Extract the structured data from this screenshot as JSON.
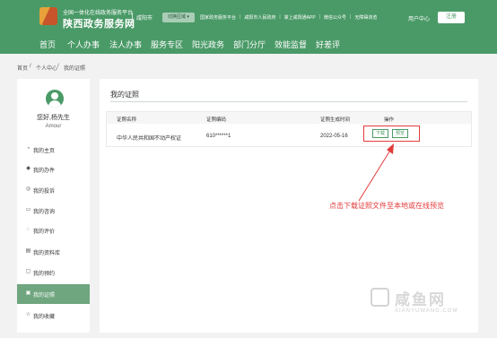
{
  "header": {
    "subtitle": "全国一体化在线政务服务平台",
    "site_title": "陕西政务服务网",
    "city": "咸阳市",
    "region_button": "切换区域 ▾",
    "links": [
      "国家政务服务平台",
      "咸阳市人民政府",
      "掌上咸阳通APP",
      "微信公众号",
      "无障碍浏览"
    ],
    "user_center": "用户中心",
    "register": "注册"
  },
  "nav": {
    "items": [
      "首页",
      "个人办事",
      "法人办事",
      "服务专区",
      "阳光政务",
      "部门分厅",
      "效能监督",
      "好差评"
    ]
  },
  "breadcrumb": {
    "home": "首页",
    "sep": "/",
    "personal": "个人中心",
    "current": "我的证照"
  },
  "sidebar": {
    "greeting": "您好,杨先生",
    "username": "Amour",
    "menu": [
      {
        "icon": "◔",
        "label": "我的主页"
      },
      {
        "icon": "◆",
        "label": "我的办件"
      },
      {
        "icon": "◎",
        "label": "我的投诉"
      },
      {
        "icon": "▭",
        "label": "我的咨询"
      },
      {
        "icon": "◌",
        "label": "我的评价"
      },
      {
        "icon": "▤",
        "label": "我的资料库"
      },
      {
        "icon": "▢",
        "label": "我的预约"
      },
      {
        "icon": "▣",
        "label": "我的证照"
      },
      {
        "icon": "☆",
        "label": "我的收藏"
      }
    ],
    "active_index": 7
  },
  "main": {
    "section_title": "我的证照",
    "columns": [
      "证照名称",
      "证照编码",
      "证照生成时间",
      "操作"
    ],
    "rows": [
      {
        "name": "中华人民共和国不动产权证",
        "code": "610******1",
        "date": "2022-05-16"
      }
    ],
    "download_label": "下载",
    "preview_label": "预览",
    "annotation": "点击下载证照文件至本地或在线预览"
  },
  "watermark": {
    "text": "咸鱼网",
    "url": "XIANYUWANG.COM"
  },
  "colors": {
    "brand_green": "#4a9a67",
    "annotation_red": "#e23b3b",
    "active_menu": "#6fa57f"
  }
}
